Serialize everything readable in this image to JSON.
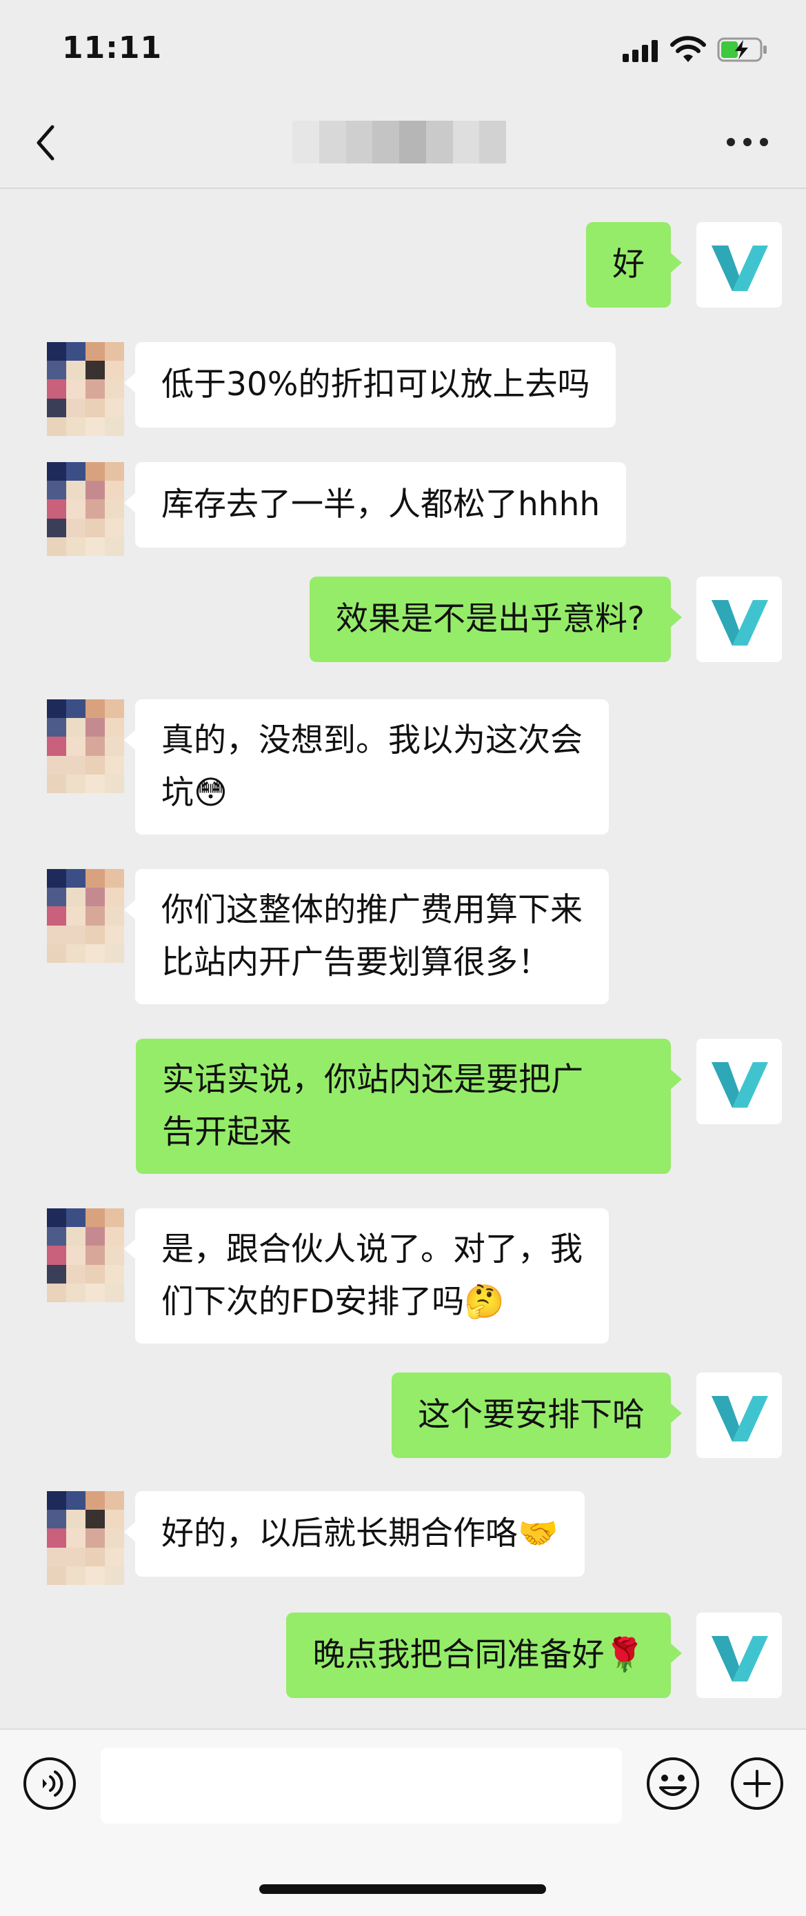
{
  "status_bar": {
    "time": "11:11"
  },
  "header": {
    "title": ""
  },
  "colors": {
    "outgoing": "#95ec69",
    "incoming": "#ffffff",
    "background": "#ededed",
    "logo": "#3fc4cf"
  },
  "messages": [
    {
      "side": "out",
      "lines": "好"
    },
    {
      "side": "in",
      "lines": "低于30%的折扣可以放上去吗"
    },
    {
      "side": "in",
      "lines": "库存去了一半，人都松了hhhh"
    },
    {
      "side": "out",
      "lines": "效果是不是出乎意料?"
    },
    {
      "side": "in",
      "lines": "真的，没想到。我以为这次会\n坑😳"
    },
    {
      "side": "in",
      "lines": "你们这整体的推广费用算下来\n比站内开广告要划算很多！"
    },
    {
      "side": "out",
      "lines": "实话实说，你站内还是要把广\n告开起来"
    },
    {
      "side": "in",
      "lines": "是，跟合伙人说了。对了，我\n们下次的FD安排了吗🤔"
    },
    {
      "side": "out",
      "lines": "这个要安排下哈"
    },
    {
      "side": "in",
      "lines": "好的，以后就长期合作咯🤝"
    },
    {
      "side": "out",
      "lines": "晚点我把合同准备好🌹"
    }
  ],
  "input_bar": {
    "voice_icon": "voice-icon",
    "emoji_icon": "emoji-icon",
    "plus_icon": "plus-icon"
  }
}
